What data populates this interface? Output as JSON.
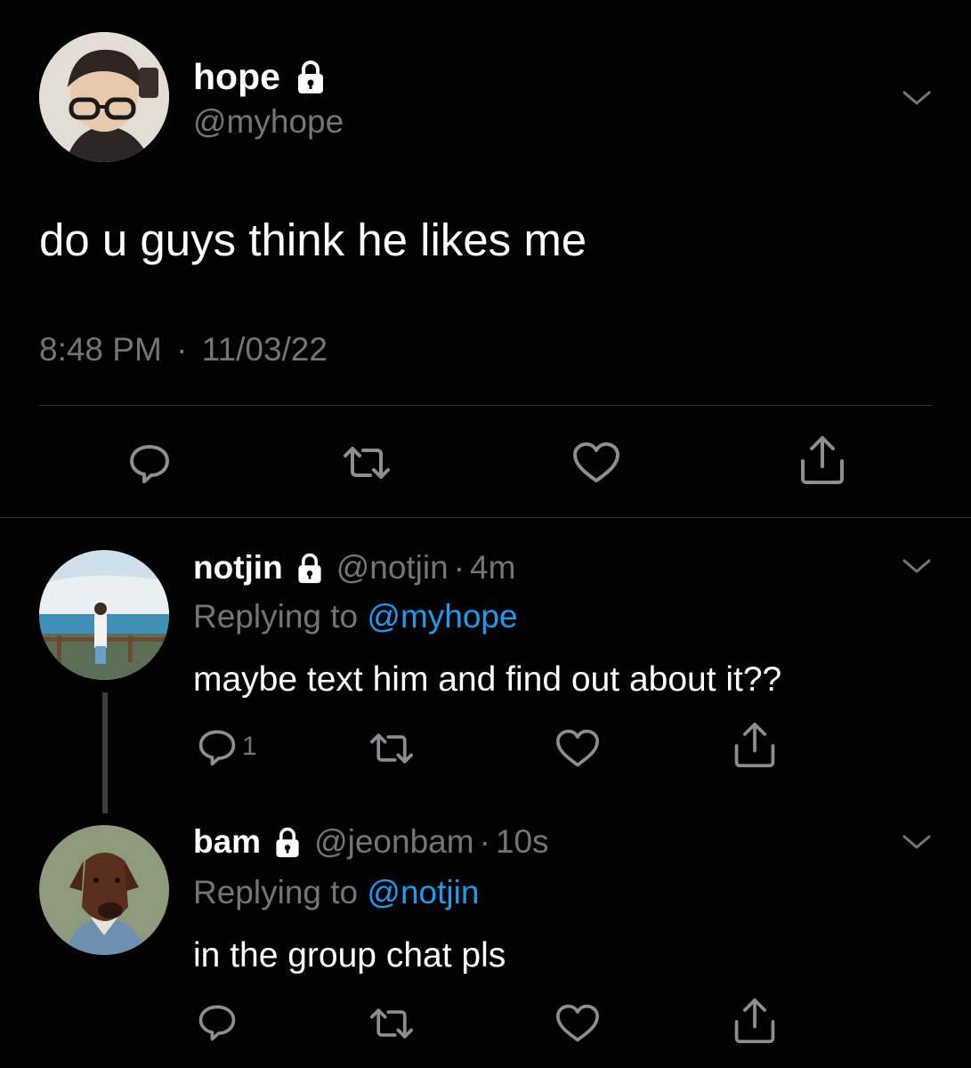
{
  "main_tweet": {
    "display_name": "hope",
    "handle": "@myhope",
    "text": "do u guys think he likes me",
    "time": "8:48 PM",
    "separator": "·",
    "date": "11/03/22"
  },
  "replies": [
    {
      "display_name": "notjin",
      "handle": "@notjin",
      "sep": "·",
      "age": "4m",
      "replying_label": "Replying to",
      "replying_to": "@myhope",
      "text": "maybe text him and find out about it??",
      "reply_count": "1"
    },
    {
      "display_name": "bam",
      "handle": "@jeonbam",
      "sep": "·",
      "age": "10s",
      "replying_label": "Replying to",
      "replying_to": "@notjin",
      "text": "in the group chat pls",
      "reply_count": ""
    }
  ],
  "colors": {
    "background": "#000000",
    "text": "#e7e9ea",
    "muted": "#71767b",
    "link": "#1d9bf0",
    "divider": "#2f3336"
  },
  "icons": [
    "lock-icon",
    "chevron-down-icon",
    "reply-icon",
    "retweet-icon",
    "like-icon",
    "share-icon"
  ]
}
